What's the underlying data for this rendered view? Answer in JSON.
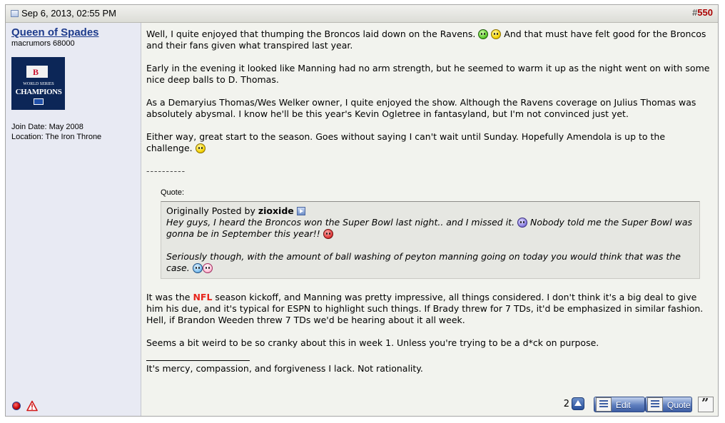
{
  "post": {
    "date": "Sep 6, 2013, 02:55 PM",
    "number_prefix": "#",
    "number": "550"
  },
  "user": {
    "name": "Queen of Spades",
    "title": "macrumors 68000",
    "avatar_text": {
      "banner": "B",
      "world_series": "WORLD SERIES",
      "champions": "CHAMPIONS"
    },
    "join_date": "Join Date: May 2008",
    "location": "Location: The Iron Throne"
  },
  "message": {
    "p1_before": "Well, I quite enjoyed that thumping the Broncos laid down on the Ravens.",
    "p1_after": "And that must have felt good for the Broncos and their fans given what transpired last year.",
    "p2": "Early in the evening it looked like Manning had no arm strength, but he seemed to warm it up as the night went on with some nice deep balls to D. Thomas.",
    "p3": "As a Demaryius Thomas/Wes Welker owner, I quite enjoyed the show. Although the Ravens coverage on Julius Thomas was absolutely abysmal. I know he'll be this year's Kevin Ogletree in fantasyland, but I'm not convinced just yet.",
    "p4": "Either way, great start to the season. Goes without saying I can't wait until Sunday. Hopefully Amendola is up to the challenge.",
    "separator": "----------",
    "quote_label": "Quote:",
    "quote_originally": "Originally Posted by",
    "quote_author": "zioxide",
    "quote_p1_a": "Hey guys, I heard the Broncos won the Super Bowl last night.. and I missed it.",
    "quote_p1_b": "Nobody told me the Super Bowl was gonna be in September this year!!",
    "quote_p2": "Seriously though, with the amount of ball washing of peyton manning going on today you would think that was the case.",
    "p5_a": "It was the",
    "p5_link": "NFL",
    "p5_b": "season kickoff, and Manning was pretty impressive, all things considered. I don't think it's a big deal to give him his due, and it's typical for ESPN to highlight such things. If Brady threw for 7 TDs, it'd be emphasized in similar fashion. Hell, if Brandon Weeden threw 7 TDs we'd be hearing about it all week.",
    "p6": "Seems a bit weird to be so cranky about this in week 1. Unless you're trying to be a d*ck on purpose.",
    "signature": "It's mercy, compassion, and forgiveness I lack. Not rationality."
  },
  "buttons": {
    "count": "2",
    "edit": "Edit",
    "quote": "Quote",
    "multi_quote": "”"
  },
  "colors": {
    "username": "#1d3b8c",
    "post_number": "#a00000",
    "nfl_link": "#e8251c",
    "button": "#3d5ea3"
  }
}
